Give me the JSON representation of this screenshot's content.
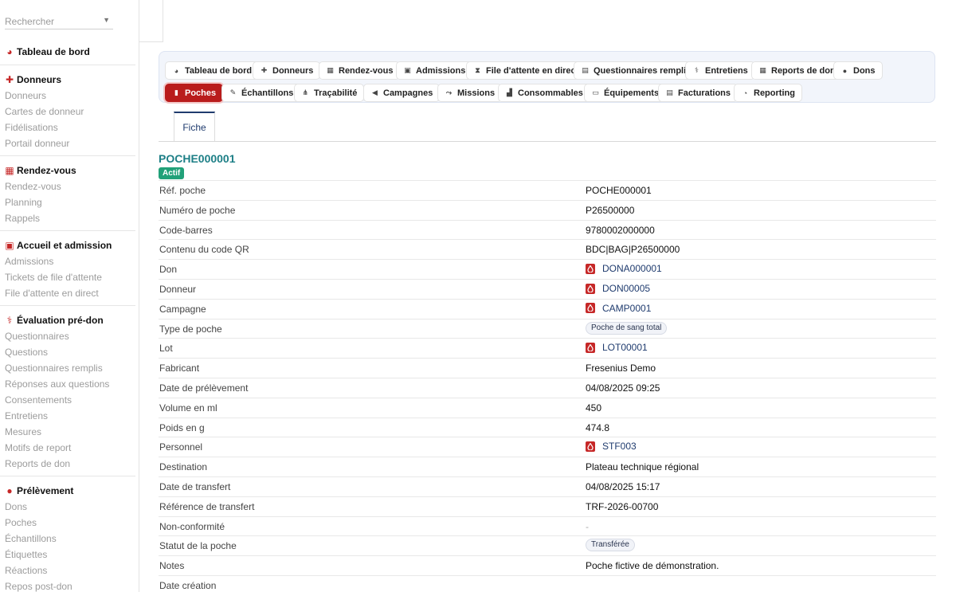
{
  "search": {
    "placeholder": "Rechercher"
  },
  "sidebar": {
    "sections": [
      {
        "title": "Tableau de bord",
        "icon": "dashboard-icon",
        "items": []
      },
      {
        "title": "Donneurs",
        "icon": "user-plus-icon",
        "items": [
          "Donneurs",
          "Cartes de donneur",
          "Fidélisations",
          "Portail donneur"
        ]
      },
      {
        "title": "Rendez-vous",
        "icon": "calendar-icon",
        "items": [
          "Rendez-vous",
          "Planning",
          "Rappels"
        ]
      },
      {
        "title": "Accueil et admission",
        "icon": "clipboard-check-icon",
        "items": [
          "Admissions",
          "Tickets de file d'attente",
          "File d'attente en direct"
        ]
      },
      {
        "title": "Évaluation pré-don",
        "icon": "stethoscope-icon",
        "items": [
          "Questionnaires",
          "Questions",
          "Questionnaires remplis",
          "Réponses aux questions",
          "Consentements",
          "Entretiens",
          "Mesures",
          "Motifs de report",
          "Reports de don"
        ]
      },
      {
        "title": "Prélèvement",
        "icon": "blood-drop-icon",
        "items": [
          "Dons",
          "Poches",
          "Échantillons",
          "Étiquettes",
          "Réactions",
          "Repos post-don"
        ]
      }
    ]
  },
  "tabs": [
    {
      "label": "Tableau de bord",
      "icon": "dashboard-icon"
    },
    {
      "label": "Donneurs",
      "icon": "user-plus-icon"
    },
    {
      "label": "Rendez-vous",
      "icon": "calendar-icon"
    },
    {
      "label": "Admissions",
      "icon": "clipboard-check-icon"
    },
    {
      "label": "File d'attente en direct",
      "icon": "hourglass-icon"
    },
    {
      "label": "Questionnaires remplis",
      "icon": "poll-icon"
    },
    {
      "label": "Entretiens",
      "icon": "stethoscope-icon"
    },
    {
      "label": "Reports de don",
      "icon": "calendar-x-icon"
    },
    {
      "label": "Dons",
      "icon": "blood-drop-icon"
    },
    {
      "label": "Poches",
      "icon": "blood-bag-icon"
    },
    {
      "label": "Échantillons",
      "icon": "pipette-icon"
    },
    {
      "label": "Traçabilité",
      "icon": "network-icon"
    },
    {
      "label": "Campagnes",
      "icon": "megaphone-icon"
    },
    {
      "label": "Missions",
      "icon": "route-icon"
    },
    {
      "label": "Consommables",
      "icon": "boxes-icon"
    },
    {
      "label": "Équipements",
      "icon": "desktop-icon"
    },
    {
      "label": "Facturations",
      "icon": "invoice-icon"
    },
    {
      "label": "Reporting",
      "icon": "pie-chart-icon"
    }
  ],
  "active_tab": "Poches",
  "subtab": {
    "label": "Fiche"
  },
  "record": {
    "title": "POCHE000001",
    "status_badge": "Actif",
    "fields": [
      {
        "label": "Réf. poche",
        "value": "POCHE000001",
        "kind": "text"
      },
      {
        "label": "Numéro de poche",
        "value": "P26500000",
        "kind": "text"
      },
      {
        "label": "Code-barres",
        "value": "9780002000000",
        "kind": "text"
      },
      {
        "label": "Contenu du code QR",
        "value": "BDC|BAG|P26500000",
        "kind": "text"
      },
      {
        "label": "Don",
        "value": "DONA000001",
        "kind": "link"
      },
      {
        "label": "Donneur",
        "value": "DON00005",
        "kind": "link"
      },
      {
        "label": "Campagne",
        "value": "CAMP0001",
        "kind": "link"
      },
      {
        "label": "Type de poche",
        "value": "Poche de sang total",
        "kind": "pill"
      },
      {
        "label": "Lot",
        "value": "LOT00001",
        "kind": "link"
      },
      {
        "label": "Fabricant",
        "value": "Fresenius Demo",
        "kind": "text"
      },
      {
        "label": "Date de prélèvement",
        "value": "04/08/2025 09:25",
        "kind": "text"
      },
      {
        "label": "Volume en ml",
        "value": "450",
        "kind": "text"
      },
      {
        "label": "Poids en g",
        "value": "474.8",
        "kind": "text"
      },
      {
        "label": "Personnel",
        "value": "STF003",
        "kind": "link"
      },
      {
        "label": "Destination",
        "value": "Plateau technique régional",
        "kind": "text"
      },
      {
        "label": "Date de transfert",
        "value": "04/08/2025 15:17",
        "kind": "text"
      },
      {
        "label": "Référence de transfert",
        "value": "TRF-2026-00700",
        "kind": "text"
      },
      {
        "label": "Non-conformité",
        "value": "-",
        "kind": "dash"
      },
      {
        "label": "Statut de la poche",
        "value": "Transférée",
        "kind": "pill"
      },
      {
        "label": "Notes",
        "value": "Poche fictive de démonstration.",
        "kind": "text"
      },
      {
        "label": "Date création",
        "value": "",
        "kind": "text"
      }
    ]
  },
  "colors": {
    "accent": "#b91c1c",
    "title": "#1d7f86",
    "link": "#1f3b6e",
    "badge": "#21a179"
  }
}
